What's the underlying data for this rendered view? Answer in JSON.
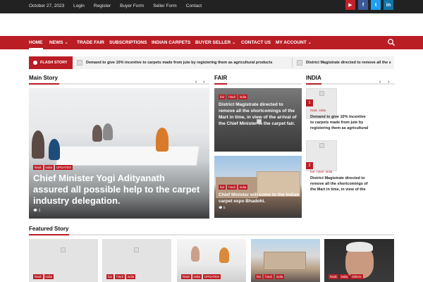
{
  "topbar": {
    "date": "October 27, 2023",
    "links": [
      "Login",
      "Register",
      "Buyer Form",
      "Seller Form",
      "Contact"
    ],
    "social": [
      {
        "icon": "youtube-icon",
        "glyph": "▶"
      },
      {
        "icon": "facebook-icon",
        "glyph": "f"
      },
      {
        "icon": "twitter-icon",
        "glyph": "t"
      },
      {
        "icon": "linkedin-icon",
        "glyph": "in"
      }
    ]
  },
  "nav": {
    "items": [
      "HOME",
      "NEWS",
      "TRADE FAIR",
      "SUBSCRIPTIONS",
      "INDIAN CARPETS",
      "BUYER SELLER",
      "CONTACT US",
      "MY ACCOUNT"
    ],
    "dropdown_marker": "⌄",
    "search_icon": "search-icon"
  },
  "flash": {
    "label": "FLASH STORY",
    "items": [
      "Demand to give 10% incentive to carpets made from jute by registering them as agricultural products",
      "District Magistrate directed to remove all the s"
    ]
  },
  "main_story": {
    "section_title": "Main Story",
    "prev": "‹",
    "next": "›",
    "tags": [
      "hindi",
      "india",
      "UPDATES"
    ],
    "headline": "Chief Minister Yogi Adityanath assured all possible help to the carpet industry delegation.",
    "comments": "💬 1"
  },
  "fair": {
    "section_title": "FAIR",
    "cards": [
      {
        "tags": [
          "fair",
          "hindi",
          "india"
        ],
        "title": "District Magistrate directed to remove all the shortcomings of the Mart in time, in view of the arrival of the Chief Minister in the carpet fair.",
        "comments": "💬 0"
      },
      {
        "tags": [
          "fair",
          "hindi",
          "india"
        ],
        "title": "Chief Minister will come to the Indian carpet expo Bhadohi.",
        "comments": "💬 0"
      }
    ]
  },
  "india": {
    "section_title": "INDIA",
    "prev": "‹",
    "next": "›",
    "items": [
      {
        "num": "1",
        "tags": [
          "hindi",
          "india"
        ],
        "text": "Demand to give 10% incentive to carpets made from jute by registering them as agricultural"
      },
      {
        "num": "2",
        "tags": [
          "fair",
          "hindi",
          "india"
        ],
        "text": "District Magistrate directed to remove all the shortcomings of the Mart in time, in view of the"
      }
    ]
  },
  "featured": {
    "section_title": "Featured Story",
    "cards": [
      {
        "tags": [
          "hindi",
          "india"
        ]
      },
      {
        "tags": [
          "fair",
          "hindi",
          "india"
        ]
      },
      {
        "tags": [
          "hindi",
          "india",
          "UPDATES"
        ]
      },
      {
        "tags": [
          "fair",
          "hindi",
          "india"
        ]
      },
      {
        "tags": [
          "hindi",
          "india",
          "Others"
        ]
      }
    ]
  },
  "colors": {
    "brand_red": "#bb1d25",
    "topbar": "#222222"
  }
}
